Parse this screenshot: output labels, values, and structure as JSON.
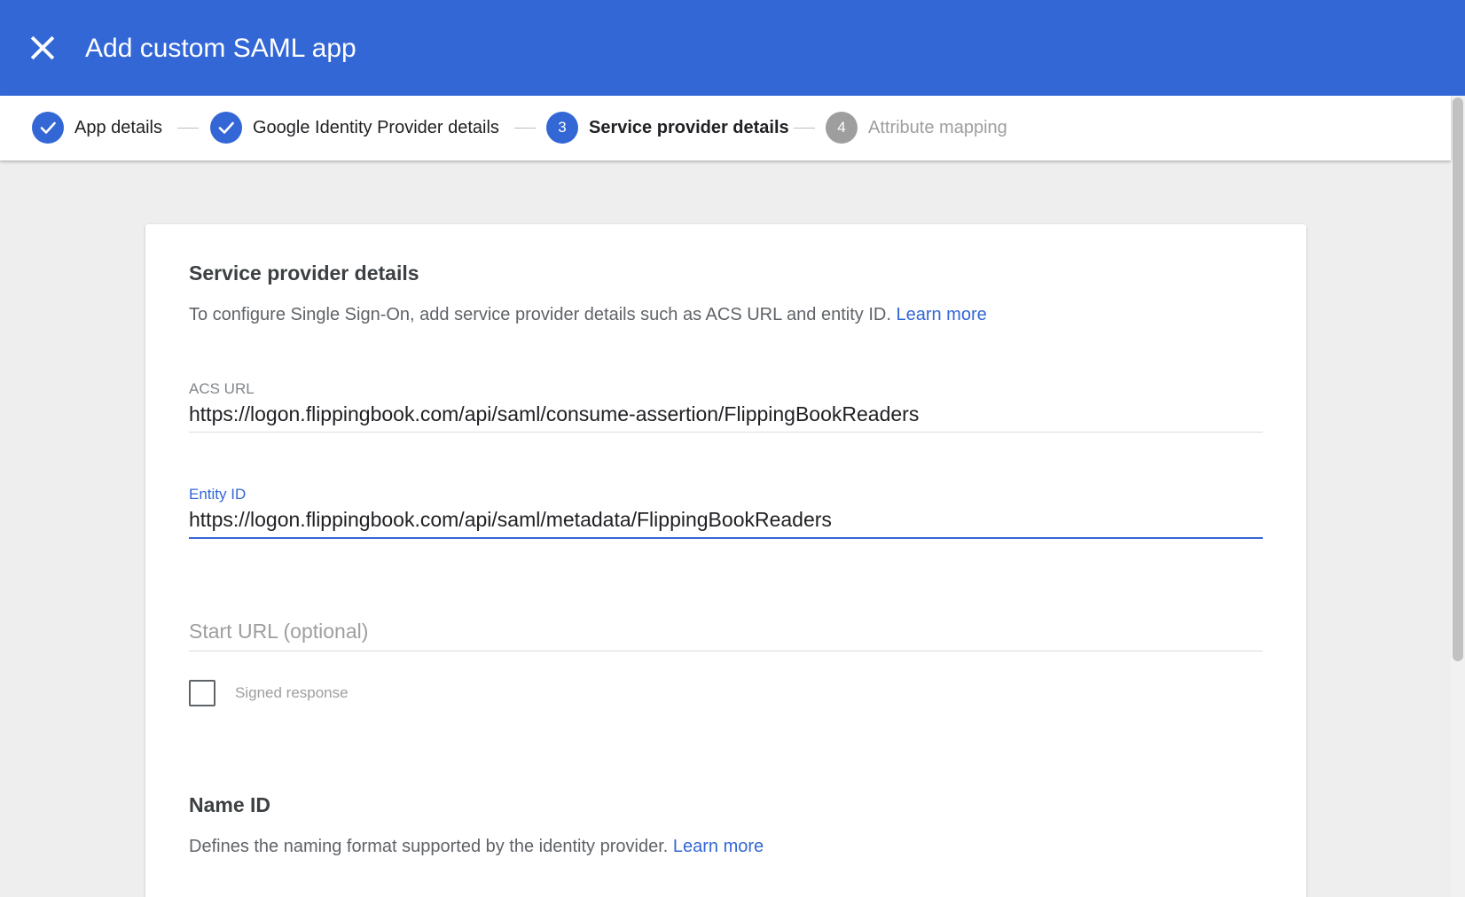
{
  "header": {
    "title": "Add custom SAML app",
    "close_icon": "close-icon",
    "background_color": "#3367d6"
  },
  "stepper": {
    "steps": [
      {
        "number": "1",
        "label": "App details",
        "state": "done",
        "icon": "check-icon"
      },
      {
        "number": "2",
        "label": "Google Identity Provider details",
        "state": "done",
        "icon": "check-icon"
      },
      {
        "number": "3",
        "label": "Service provider details",
        "state": "active"
      },
      {
        "number": "4",
        "label": "Attribute mapping",
        "state": "todo"
      }
    ]
  },
  "sp_section": {
    "title": "Service provider details",
    "description": "To configure Single Sign-On, add service provider details such as ACS URL and entity ID.",
    "learn_more": "Learn more"
  },
  "fields": {
    "acs_url": {
      "label": "ACS URL",
      "value": "https://logon.flippingbook.com/api/saml/consume-assertion/FlippingBookReaders"
    },
    "entity_id": {
      "label": "Entity ID",
      "value": "https://logon.flippingbook.com/api/saml/metadata/FlippingBookReaders"
    },
    "start_url": {
      "placeholder": "Start URL (optional)",
      "value": ""
    }
  },
  "signed_response": {
    "label": "Signed response",
    "checked": false
  },
  "name_id_section": {
    "title": "Name ID",
    "description": "Defines the naming format supported by the identity provider.",
    "learn_more": "Learn more"
  },
  "colors": {
    "accent": "#3367d6",
    "inactive_step": "#9e9e9e",
    "page_background": "#eeeeee"
  }
}
